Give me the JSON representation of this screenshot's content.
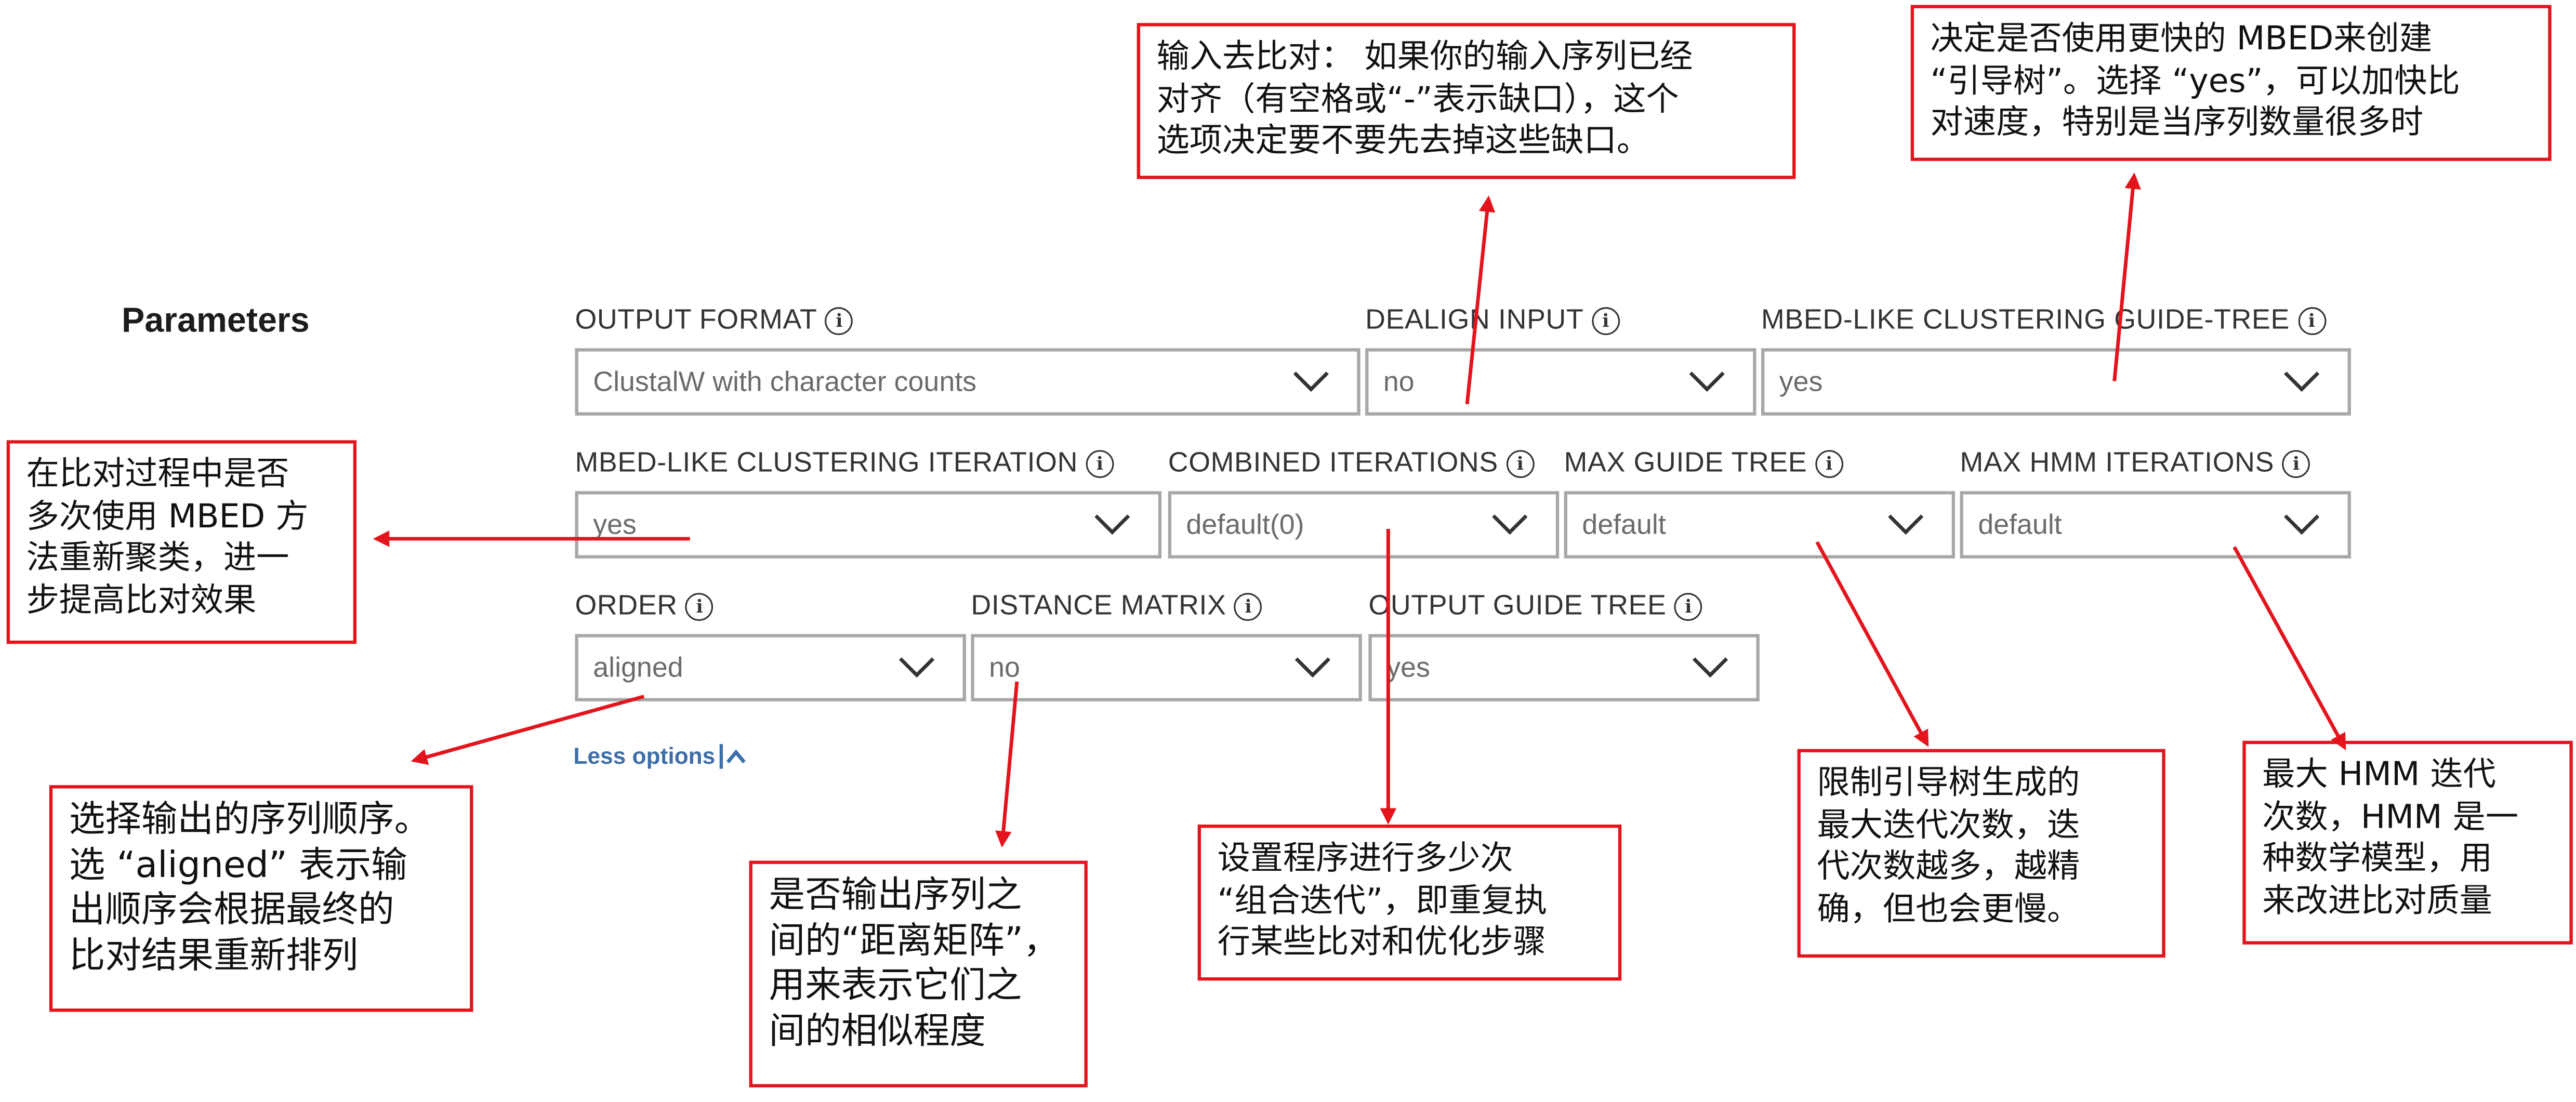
{
  "section_title": "Parameters",
  "fields": {
    "output_format": {
      "label": "OUTPUT FORMAT",
      "value": "ClustalW with character counts"
    },
    "dealign_input": {
      "label": "DEALIGN INPUT",
      "value": "no"
    },
    "mbed_guide_tree": {
      "label": "MBED-LIKE CLUSTERING GUIDE-TREE",
      "value": "yes"
    },
    "mbed_iteration": {
      "label": "MBED-LIKE CLUSTERING ITERATION",
      "value": "yes"
    },
    "combined_iterations": {
      "label": "COMBINED ITERATIONS",
      "value": "default(0)"
    },
    "max_guide_tree": {
      "label": "MAX GUIDE TREE",
      "value": "default"
    },
    "max_hmm_iterations": {
      "label": "MAX HMM ITERATIONS",
      "value": "default"
    },
    "order": {
      "label": "ORDER",
      "value": "aligned"
    },
    "distance_matrix": {
      "label": "DISTANCE MATRIX",
      "value": "no"
    },
    "output_guide_tree": {
      "label": "OUTPUT GUIDE TREE",
      "value": "yes"
    }
  },
  "less_options_label": "Less options",
  "info_icon": "info-circle-icon",
  "dropdown_icon": "chevron-down-icon",
  "annotations": {
    "dealign": "输入去比对： 如果你的输入序列已经\n对齐（有空格或“-”表示缺口），这个\n选项决定要不要先去掉这些缺口。",
    "mbed_tree": "决定是否使用更快的 MBED来创建\n“引导树”。选择 “yes”，可以加快比\n对速度，特别是当序列数量很多时",
    "mbed_iter": "在比对过程中是否\n多次使用 MBED 方\n法重新聚类，进一\n步提高比对效果",
    "order": "选择输出的序列顺序。\n选 “aligned” 表示输\n出顺序会根据最终的\n比对结果重新排列",
    "distance": "是否输出序列之\n间的“距离矩阵”，\n用来表示它们之\n间的相似程度",
    "combined": "设置程序进行多少次\n“组合迭代”，即重复执\n行某些比对和优化步骤",
    "max_guide": "限制引导树生成的\n最大迭代次数，迭\n代次数越多，越精\n确，但也会更慢。",
    "max_hmm": "最大 HMM 迭代\n次数，HMM 是一\n种数学模型，用\n来改进比对质量"
  },
  "colors": {
    "annotation_red": "#e3141c",
    "link_blue": "#3d6ea8",
    "field_border": "#a7a7a7"
  }
}
